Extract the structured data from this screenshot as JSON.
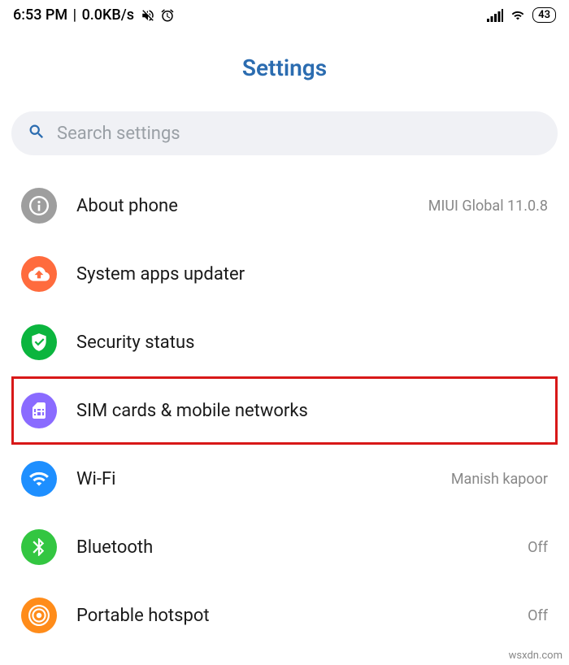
{
  "status_bar": {
    "time": "6:53 PM",
    "network_speed": "0.0KB/s",
    "battery": "43"
  },
  "page_title": "Settings",
  "search": {
    "placeholder": "Search settings"
  },
  "items": [
    {
      "label": "About phone",
      "value": "MIUI Global 11.0.8",
      "icon": "info",
      "color": "#9e9e9e",
      "highlighted": false
    },
    {
      "label": "System apps updater",
      "value": "",
      "icon": "cloud-up",
      "color": "#ff6b3d",
      "highlighted": false
    },
    {
      "label": "Security status",
      "value": "",
      "icon": "shield",
      "color": "#0bb53e",
      "highlighted": false
    },
    {
      "label": "SIM cards & mobile networks",
      "value": "",
      "icon": "sim",
      "color": "#8a6bff",
      "highlighted": true
    },
    {
      "label": "Wi-Fi",
      "value": "Manish kapoor",
      "icon": "wifi",
      "color": "#1e8fff",
      "highlighted": false
    },
    {
      "label": "Bluetooth",
      "value": "Off",
      "icon": "bluetooth",
      "color": "#33c641",
      "highlighted": false
    },
    {
      "label": "Portable hotspot",
      "value": "Off",
      "icon": "hotspot",
      "color": "#ff8c1a",
      "highlighted": false
    }
  ],
  "watermark": "wsxdn.com"
}
